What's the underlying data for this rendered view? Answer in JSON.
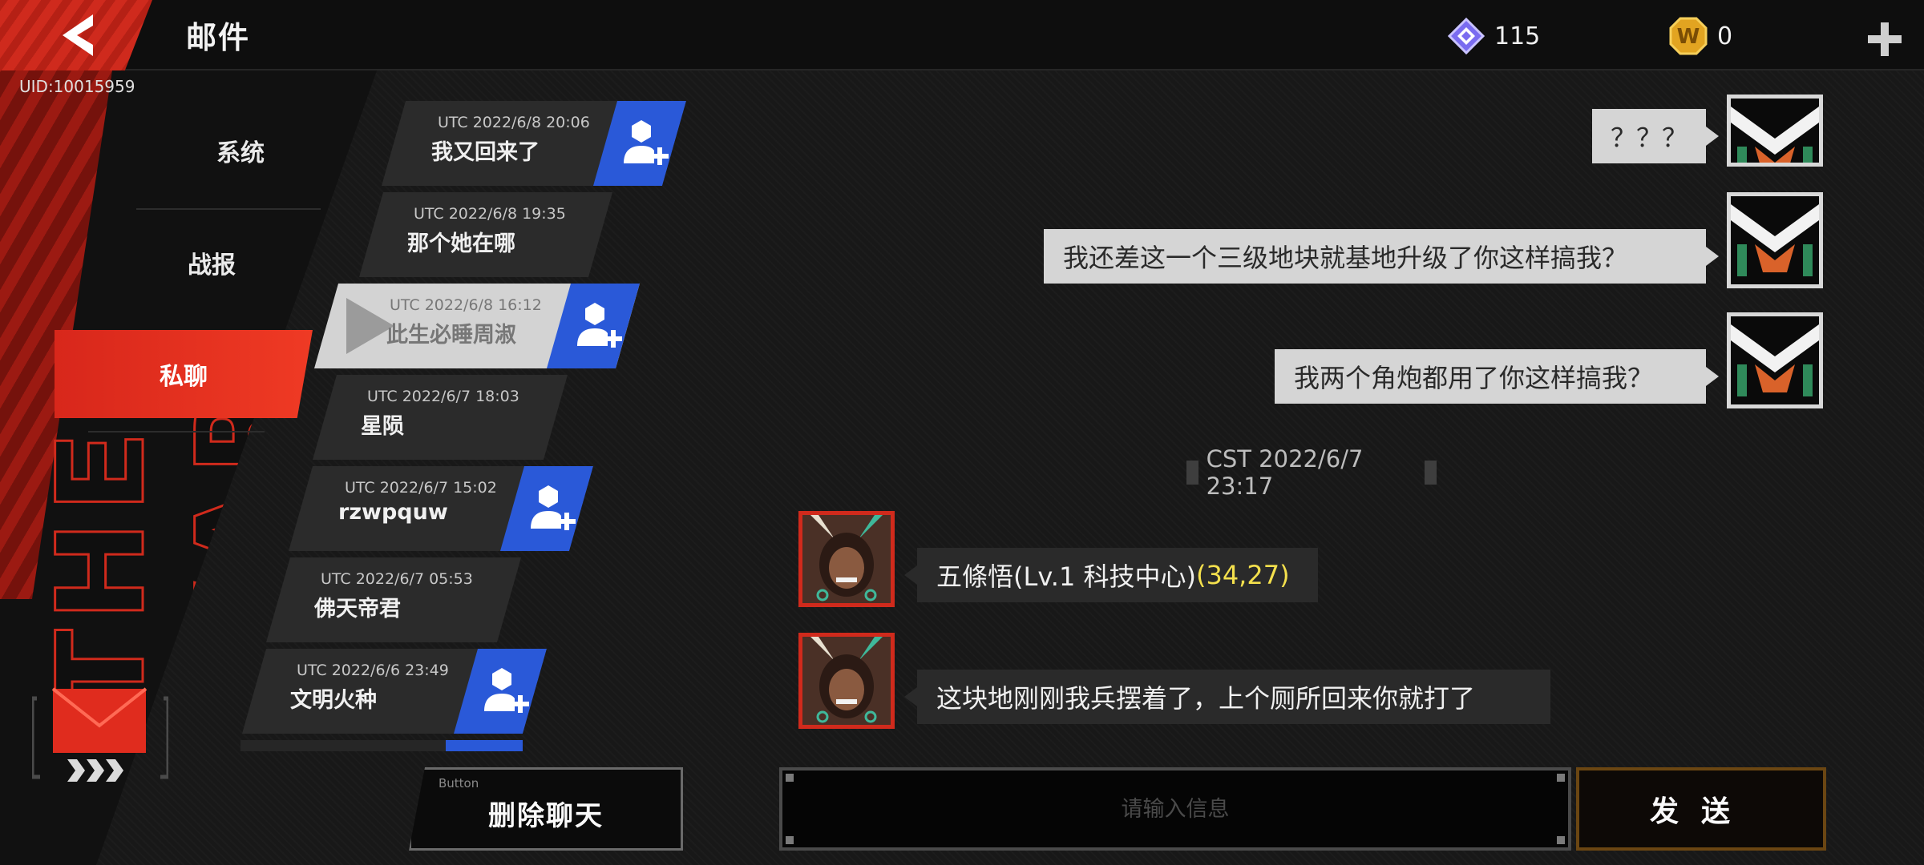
{
  "header": {
    "title": "邮件",
    "uid": "UID:10015959",
    "gems": "115",
    "coins": "0"
  },
  "categories": [
    {
      "label": "系统"
    },
    {
      "label": "战报"
    },
    {
      "label": "私聊"
    }
  ],
  "decor_text": "THE WAR",
  "conversations": [
    {
      "time": "UTC 2022/6/8 20:06",
      "name": "我又回来了",
      "add_friend": true
    },
    {
      "time": "UTC 2022/6/8 19:35",
      "name": "那个她在哪",
      "add_friend": false
    },
    {
      "time": "UTC 2022/6/8 16:12",
      "name": "此生必睡周淑",
      "add_friend": true,
      "selected": true
    },
    {
      "time": "UTC 2022/6/7 18:03",
      "name": "星陨",
      "add_friend": false
    },
    {
      "time": "UTC 2022/6/7 15:02",
      "name": "rzwpquw",
      "add_friend": true
    },
    {
      "time": "UTC 2022/6/7 05:53",
      "name": "佛天帝君",
      "add_friend": false
    },
    {
      "time": "UTC 2022/6/6 23:49",
      "name": "文明火种",
      "add_friend": true
    }
  ],
  "delete_button": {
    "tag": "Button",
    "label": "删除聊天"
  },
  "chat": {
    "messages_mine": [
      {
        "text": "？？？"
      },
      {
        "text": "我还差这一个三级地块就基地升级了你这样搞我？"
      },
      {
        "text": "我两个角炮都用了你这样搞我？"
      }
    ],
    "timestamp": "CST 2022/6/7 23:17",
    "messages_theirs": [
      {
        "sender": "五條悟(Lv.1 科技中心)",
        "coords": "(34,27)"
      },
      {
        "text": "这块地刚刚我兵摆着了，上个厕所回来你就打了"
      }
    ]
  },
  "input": {
    "placeholder": "请输入信息",
    "value": ""
  },
  "send_button": {
    "label": "发送"
  },
  "colors": {
    "accent_red": "#d8271b",
    "friend_blue": "#2a59d8",
    "coord_yellow": "#f4e04d",
    "send_border": "#6b4612"
  }
}
